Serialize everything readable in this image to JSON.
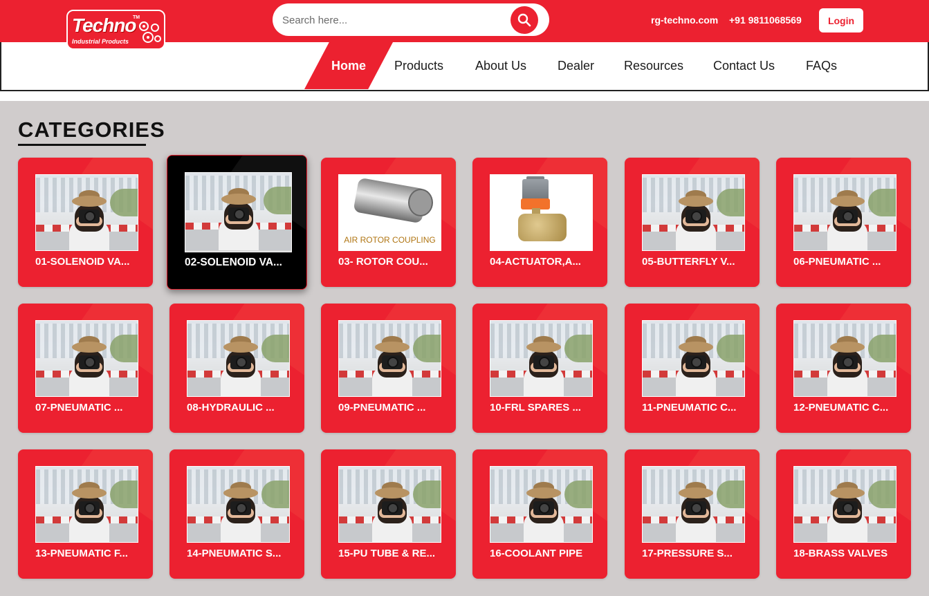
{
  "header": {
    "logo": {
      "name": "Techno",
      "tagline": "Industrial Products",
      "tm": "TM"
    },
    "search": {
      "placeholder": "Search here..."
    },
    "website": "rg-techno.com",
    "phone": "+91 9811068569",
    "login_label": "Login",
    "brand_color": "#ec2130"
  },
  "nav": {
    "items": [
      {
        "label": "Home",
        "active": true
      },
      {
        "label": "Products"
      },
      {
        "label": "About Us"
      },
      {
        "label": "Dealer"
      },
      {
        "label": "Resources"
      },
      {
        "label": "Contact Us"
      },
      {
        "label": "FAQs"
      }
    ]
  },
  "categories": {
    "title": "CATEGORIES",
    "items": [
      {
        "label": "01-SOLENOID VA...",
        "image": "photo"
      },
      {
        "label": "02-SOLENOID VA...",
        "image": "photo",
        "hovered": true
      },
      {
        "label": "03- ROTOR COU...",
        "image": "rotor-coupling",
        "image_text": "AIR ROTOR COUPLING"
      },
      {
        "label": "04-ACTUATOR,A...",
        "image": "actuator-valve"
      },
      {
        "label": "05-BUTTERFLY V...",
        "image": "photo"
      },
      {
        "label": "06-PNEUMATIC ...",
        "image": "photo"
      },
      {
        "label": "07-PNEUMATIC ...",
        "image": "photo"
      },
      {
        "label": "08-HYDRAULIC ...",
        "image": "photo"
      },
      {
        "label": "09-PNEUMATIC ...",
        "image": "photo"
      },
      {
        "label": "10-FRL SPARES ...",
        "image": "photo"
      },
      {
        "label": "11-PNEUMATIC C...",
        "image": "photo"
      },
      {
        "label": "12-PNEUMATIC C...",
        "image": "photo"
      },
      {
        "label": "13-PNEUMATIC F...",
        "image": "photo"
      },
      {
        "label": "14-PNEUMATIC S...",
        "image": "photo"
      },
      {
        "label": "15-PU TUBE & RE...",
        "image": "photo"
      },
      {
        "label": "16-COOLANT PIPE",
        "image": "photo"
      },
      {
        "label": "17-PRESSURE S...",
        "image": "photo"
      },
      {
        "label": "18-BRASS VALVES",
        "image": "photo"
      }
    ]
  }
}
